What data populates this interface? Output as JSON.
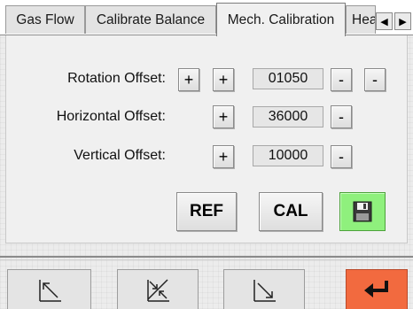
{
  "tabs": [
    {
      "label": "Gas Flow"
    },
    {
      "label": "Calibrate Balance"
    },
    {
      "label": "Mech. Calibration"
    },
    {
      "label": "Hea"
    }
  ],
  "tab_scroll": {
    "left_icon": "◀",
    "right_icon": "▶"
  },
  "rows": [
    {
      "label": "Rotation Offset:",
      "value": "01050"
    },
    {
      "label": "Horizontal Offset:",
      "value": "36000"
    },
    {
      "label": "Vertical Offset:",
      "value": "10000"
    }
  ],
  "controls": {
    "plus": "+",
    "minus": "-"
  },
  "actions": {
    "ref_label": "REF",
    "cal_label": "CAL",
    "save_icon": "floppy-disk-icon"
  },
  "footer": {
    "buttons": [
      "arrow-up-left-icon",
      "arrows-converge-icon",
      "arrow-down-right-icon",
      "back-enter-icon"
    ],
    "back_color": "#f26a3f"
  },
  "colors": {
    "save_button": "#8ff07d",
    "background": "#ececec"
  }
}
